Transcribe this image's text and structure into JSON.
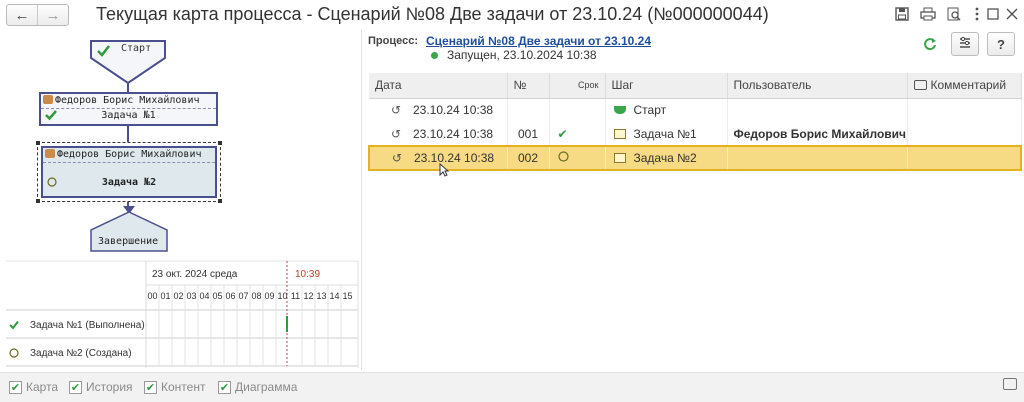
{
  "window": {
    "title": "Текущая карта процесса - Сценарий №08 Две задачи от 23.10.24 (№000000044)",
    "nav_back": "←",
    "nav_forward": "→",
    "toolbar_icons": [
      "save-icon",
      "print-icon",
      "preview-icon",
      "more-icon",
      "maximize-icon",
      "close-icon"
    ]
  },
  "map": {
    "start_label": "Старт",
    "task1": {
      "user": "Федоров Борис Михайлович",
      "name": "Задача №1"
    },
    "task2": {
      "user": "Федоров Борис Михайлович",
      "name": "Задача №2"
    },
    "end_label": "Завершение",
    "colors": {
      "node_border": "#4b4e8f",
      "check": "#2f9a3e",
      "selected_bg": "#dfe9ed"
    }
  },
  "gantt": {
    "date": "23 окт. 2024 среда",
    "now": "10:39",
    "hours": [
      "00",
      "01",
      "02",
      "03",
      "04",
      "05",
      "06",
      "07",
      "08",
      "09",
      "10",
      "11",
      "12",
      "13",
      "14",
      "15"
    ],
    "rows": [
      {
        "label": "Задача №1 (Выполнена)",
        "state": "done"
      },
      {
        "label": "Задача №2 (Создана)",
        "state": "created"
      }
    ]
  },
  "process": {
    "label": "Процесс:",
    "link": "Сценарий №08 Две задачи от 23.10.24",
    "status": "Запущен, 23.10.2024 10:38",
    "status_color": "#3aa54a",
    "buttons": [
      "refresh-icon",
      "settings-icon",
      "?"
    ]
  },
  "history": {
    "columns": [
      "Дата",
      "№",
      "Срок",
      "Шаг",
      "Пользователь",
      "Комментарий"
    ],
    "rows": [
      {
        "date": "23.10.24 10:38",
        "num": "",
        "step": "Старт",
        "user": "",
        "comment": "",
        "deadline": ""
      },
      {
        "date": "23.10.24 10:38",
        "num": "001",
        "step": "Задача №1",
        "user": "Федоров Борис Михайлович",
        "comment": "",
        "deadline": "done"
      },
      {
        "date": "23.10.24 10:38",
        "num": "002",
        "step": "Задача №2",
        "user": "",
        "comment": "",
        "deadline": "open",
        "selected": true
      }
    ],
    "selected_color": "#f6da84"
  },
  "footer": {
    "options": [
      "Карта",
      "История",
      "Контент",
      "Диаграмма"
    ]
  }
}
